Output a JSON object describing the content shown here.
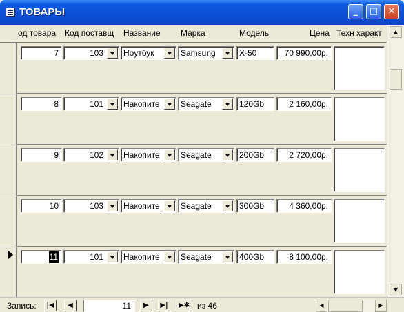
{
  "window": {
    "title": "ТОВАРЫ",
    "minimize": "_",
    "maximize": "□",
    "close": "✕"
  },
  "columns": [
    "од товара",
    "Код поставщ",
    "Название",
    "Марка",
    "Модель",
    "Цена",
    "Техн характ"
  ],
  "records": [
    {
      "id": "7",
      "supplier": "103",
      "name": "Ноутбук",
      "brand": "Samsung",
      "model": "X-50",
      "price": "70 990,00р."
    },
    {
      "id": "8",
      "supplier": "101",
      "name": "Накопите",
      "brand": "Seagate",
      "model": "120Gb",
      "price": "2 160,00р."
    },
    {
      "id": "9",
      "supplier": "102",
      "name": "Накопите",
      "brand": "Seagate",
      "model": "200Gb",
      "price": "2 720,00р."
    },
    {
      "id": "10",
      "supplier": "103",
      "name": "Накопите",
      "brand": "Seagate",
      "model": "300Gb",
      "price": "4 360,00р."
    },
    {
      "id": "11",
      "supplier": "101",
      "name": "Накопите",
      "brand": "Seagate",
      "model": "400Gb",
      "price": "8 100,00р."
    }
  ],
  "status": {
    "label": "Запись:",
    "current_record": "11",
    "of_label": "из  46",
    "nav_first": "|◀",
    "nav_prev": "◀",
    "nav_next": "▶",
    "nav_last": "▶|",
    "nav_new": "▶✱"
  },
  "scroll": {
    "up": "▲",
    "down": "▼",
    "left": "◀",
    "right": "▶"
  }
}
